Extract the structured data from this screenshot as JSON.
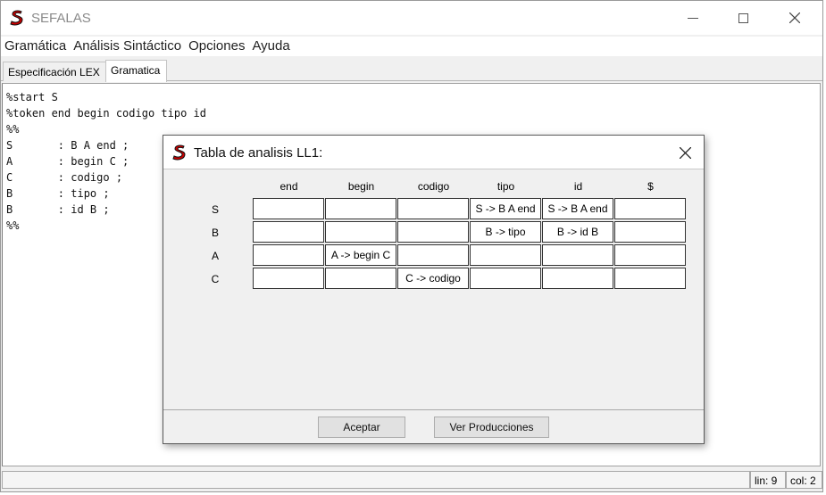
{
  "window": {
    "title": "SEFALAS",
    "accent": "#cc0000"
  },
  "menu": [
    "Gramática",
    "Análisis Sintáctico",
    "Opciones",
    "Ayuda"
  ],
  "tabs": [
    "Especificación LEX",
    "Gramatica"
  ],
  "editor": {
    "lines": [
      "%start S",
      "%token end begin codigo tipo id",
      "%%",
      "S       : B A end ;",
      "A       : begin C ;",
      "C       : codigo ;",
      "B       : tipo ;",
      "B       : id B ;",
      "%%"
    ]
  },
  "status": {
    "line": "lin: 9",
    "col": "col: 2"
  },
  "dialog": {
    "title": "Tabla de analisis LL1:",
    "headers": [
      "end",
      "begin",
      "codigo",
      "tipo",
      "id",
      "$"
    ],
    "rows": [
      {
        "label": "S",
        "cells": [
          "",
          "",
          "",
          "S -> B A end",
          "S -> B A end",
          ""
        ]
      },
      {
        "label": "B",
        "cells": [
          "",
          "",
          "",
          "B -> tipo",
          "B -> id B",
          ""
        ]
      },
      {
        "label": "A",
        "cells": [
          "",
          "A -> begin C",
          "",
          "",
          "",
          ""
        ]
      },
      {
        "label": "C",
        "cells": [
          "",
          "",
          "C -> codigo",
          "",
          "",
          ""
        ]
      }
    ],
    "ok_label": "Aceptar",
    "productions_label": "Ver Producciones"
  }
}
